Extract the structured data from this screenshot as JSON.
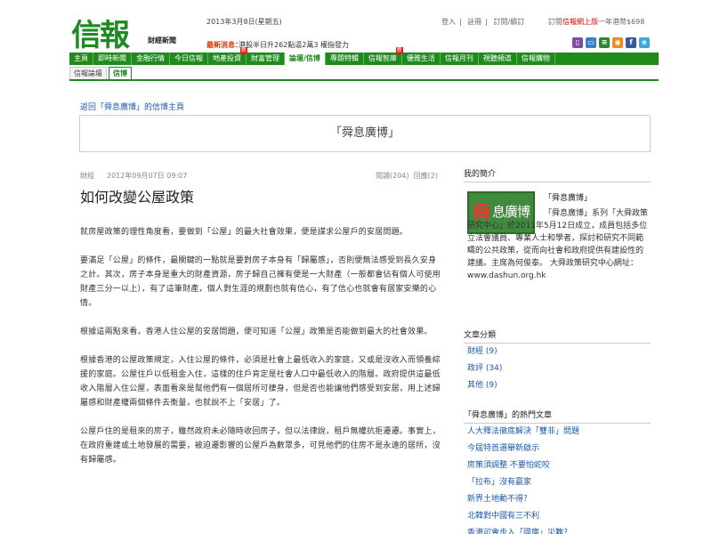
{
  "header": {
    "logo": "信報",
    "logo_sub": "財經新聞",
    "date": "2013年3月8日(星期五)",
    "ticker_label": "最新消息：",
    "ticker": "港股半日升262點逼2萬3 權指發力",
    "top_links": [
      "登入",
      "註冊",
      "訂閱/續訂"
    ],
    "subscribe_prefix": "訂閱",
    "subscribe_red": "信報網上版",
    "subscribe_suffix": "一年港幣$698"
  },
  "icons": [
    {
      "name": "mobile-icon",
      "glyph": "▯",
      "color": "#7e4ca3"
    },
    {
      "name": "tablet-icon",
      "glyph": "▭",
      "color": "#3a7ec4"
    },
    {
      "name": "news-icon",
      "glyph": "≡",
      "color": "#2c8a2c"
    },
    {
      "name": "rss-icon",
      "glyph": "◉",
      "color": "#f08a1c"
    },
    {
      "name": "facebook-icon",
      "glyph": "f",
      "color": "#3b5998"
    },
    {
      "name": "weibo-icon",
      "glyph": "e",
      "color": "#3ea6d8"
    }
  ],
  "nav": [
    {
      "label": "主頁"
    },
    {
      "label": "即時新聞"
    },
    {
      "label": "金融行情"
    },
    {
      "label": "今日信報"
    },
    {
      "label": "地產投資",
      "badge": "新"
    },
    {
      "label": "財富管理"
    },
    {
      "label": "論壇/信博",
      "active": true
    },
    {
      "label": "專題特輯"
    },
    {
      "label": "信報智庫",
      "badge": "新"
    },
    {
      "label": "優雅生活"
    },
    {
      "label": "信報月刊"
    },
    {
      "label": "視聽頻道"
    },
    {
      "label": "信報購物"
    }
  ],
  "subnav": [
    {
      "label": "信報論壇"
    },
    {
      "label": "信博",
      "active": true
    }
  ],
  "back_link": "返回「舜息廣博」的信博主頁",
  "blog_title": "「舜息廣博」",
  "article": {
    "category": "財經",
    "datetime": "2012年09月07日 09:07",
    "views": "閱讀(204)",
    "replies": "回應(2)",
    "title": "如何改變公屋政策",
    "paragraphs": [
      "就房屋政策的理性角度看，要做到「公屋」的最大社會效果，便是謀求公屋戶的安居問題。",
      "要滿足「公屋」的條件，最關鍵的一點就是要對房子本身有「歸屬感」，否則便無法感受到長久安身之計。其次，房子本身是重大的財產資源，房子歸自己擁有便是一大財產（一般都會佔有個人可使用財產三分一以上），有了這筆財產，個人對生涯的規劃也就有信心，有了信心也就會有居家安樂的心情。",
      "根據這兩點來看，香港人住公屋的安居問題，便可知道「公屋」政策是否能做到最大的社會效果。",
      "根據香港的公屋政策規定，入住公屋的條件，必須是社會上最低收入的家庭，又或是沒收入而領養綜援的家庭。公屋住戶以低租金入住，這樣的住戶肯定是社會人口中最低收入的階層。政府提供這最低收入階層入住公屋，表面看來是幫他們有一個居所可棲身，但是否也能讓他們感受到安居，用上述歸屬感和財產權兩個條件去衡量，也就說不上「安居」了。",
      "公屋戶住的是租來的房子，雖然政府未必隨時收回房子，但以法律說，租戶無權抗拒遷遷。事實上，在政府重建或土地發展的需要，被迫遷影響的公屋戶為數眾多，可見他們的住房不是永遠的居所，沒有歸屬感。"
    ]
  },
  "sidebar": {
    "intro_heading": "我的簡介",
    "avatar_text_1": "舜",
    "avatar_text_2": "息廣博",
    "profile_name": "「舜息廣博」",
    "profile_desc": "「舜息廣博」系列「大舜政策研究中心」於2011年5月12日成立，成員包括多位立法會議員、專業人士和學者，探討和研究不同範疇的公共政策，從而向社會和政府提供有建設性的建議。主席為何俊泰。 大舜政策研究中心網址：www.dashun.org.hk",
    "categories_heading": "文章分類",
    "categories": [
      "財經 (9)",
      "政評 (34)",
      "其他 (9)"
    ],
    "hot_heading": "「舜息廣博」的熱門文章",
    "hot": [
      "人大釋法徹底解決「雙非」問題",
      "今屆特首選舉新啟示",
      "房策須調整 不要怕蛇咬",
      "「拉布」沒有贏家",
      "新界土地動不得？",
      "北韓對中國有三不利",
      "香港可會步入「國庫」災難？"
    ]
  }
}
